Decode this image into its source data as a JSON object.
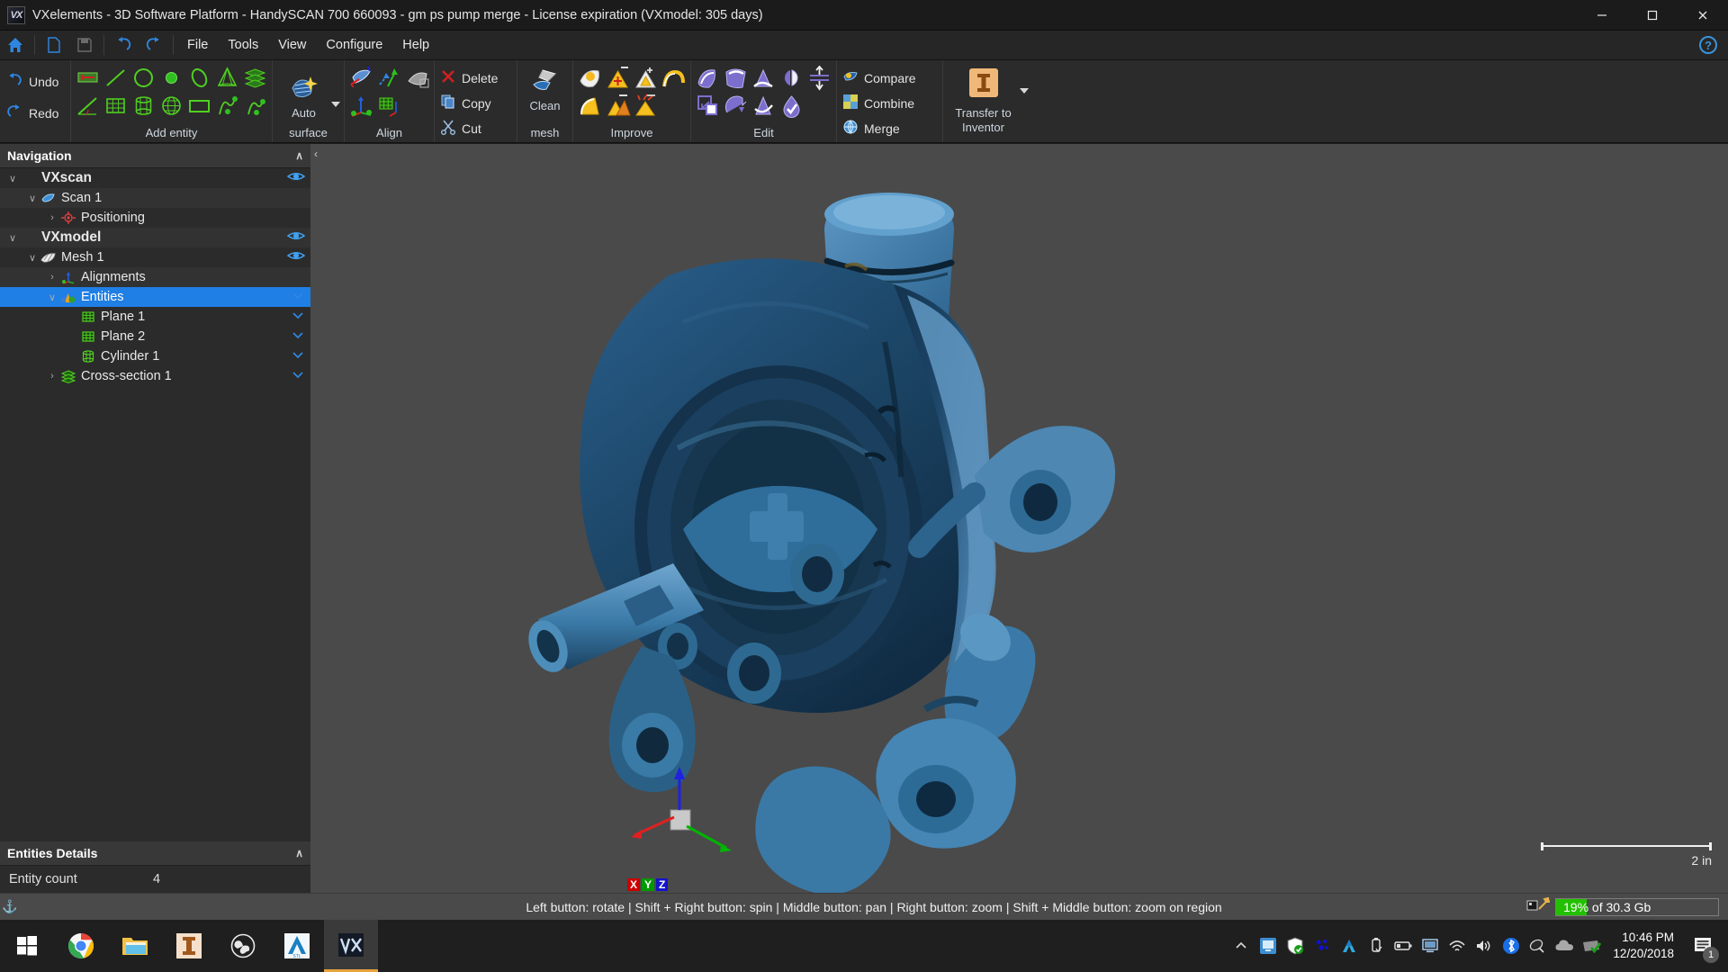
{
  "window": {
    "title": "VXelements - 3D Software Platform - HandySCAN 700 660093 - gm ps pump merge - License expiration (VXmodel: 305 days)",
    "app_icon": "vx-app-icon",
    "minimize": "—",
    "maximize": "❐",
    "close": "✕"
  },
  "menubar": {
    "icons": [
      "home-icon",
      "new-document-icon",
      "save-icon",
      "undo-nav-icon",
      "redo-nav-icon"
    ],
    "items": [
      "File",
      "Tools",
      "View",
      "Configure",
      "Help"
    ],
    "help_badge": "?"
  },
  "ribbon": {
    "history": {
      "undo_label": "Undo",
      "redo_label": "Redo"
    },
    "groups": [
      {
        "label": "Add entity"
      },
      {
        "label": "Auto\nsurface",
        "big_label_line1": "Auto",
        "big_label_line2": "surface"
      },
      {
        "label": "Align"
      },
      {
        "label": ""
      },
      {
        "label": "Clean\nmesh",
        "big_label_line1": "Clean",
        "big_label_line2": "mesh"
      },
      {
        "label": "Improve"
      },
      {
        "label": "Edit"
      },
      {
        "label": ""
      },
      {
        "label": ""
      }
    ],
    "edit_ops": {
      "delete_label": "Delete",
      "copy_label": "Copy",
      "cut_label": "Cut"
    },
    "compare_ops": {
      "compare_label": "Compare",
      "combine_label": "Combine",
      "merge_label": "Merge"
    },
    "transfer": {
      "line1": "Transfer to",
      "line2": "Inventor"
    }
  },
  "navigation": {
    "header": "Navigation",
    "collapse_chevron": "∧",
    "tree": [
      {
        "label": "VXscan",
        "indent": 0,
        "expander": "∨",
        "icon": "",
        "bold": true,
        "eye": true,
        "selected": false,
        "alt": false
      },
      {
        "label": "Scan 1",
        "indent": 1,
        "expander": "∨",
        "icon": "scan-icon",
        "bold": false,
        "eye": false,
        "selected": false,
        "alt": true
      },
      {
        "label": "Positioning",
        "indent": 2,
        "expander": "›",
        "icon": "positioning-icon",
        "bold": false,
        "eye": false,
        "selected": false,
        "alt": false
      },
      {
        "label": "VXmodel",
        "indent": 0,
        "expander": "∨",
        "icon": "",
        "bold": true,
        "eye": true,
        "selected": false,
        "alt": true
      },
      {
        "label": "Mesh 1",
        "indent": 1,
        "expander": "∨",
        "icon": "mesh-icon",
        "bold": false,
        "eye": true,
        "selected": false,
        "alt": false
      },
      {
        "label": "Alignments",
        "indent": 2,
        "expander": "›",
        "icon": "alignments-icon",
        "bold": false,
        "eye": false,
        "selected": false,
        "alt": true
      },
      {
        "label": "Entities",
        "indent": 2,
        "expander": "∨",
        "icon": "entities-icon",
        "bold": false,
        "eye": true,
        "selected": true,
        "alt": false
      },
      {
        "label": "Plane 1",
        "indent": 3,
        "expander": "",
        "icon": "plane-icon",
        "bold": false,
        "eye": true,
        "selected": false,
        "alt": false
      },
      {
        "label": "Plane 2",
        "indent": 3,
        "expander": "",
        "icon": "plane-icon",
        "bold": false,
        "eye": true,
        "selected": false,
        "alt": false
      },
      {
        "label": "Cylinder 1",
        "indent": 3,
        "expander": "",
        "icon": "cylinder-icon",
        "bold": false,
        "eye": true,
        "selected": false,
        "alt": false
      },
      {
        "label": "Cross-section 1",
        "indent": 2,
        "expander": "›",
        "icon": "cross-section-icon",
        "bold": false,
        "eye": true,
        "selected": false,
        "alt": false
      }
    ]
  },
  "entities_details": {
    "header": "Entities Details",
    "collapse_chevron": "∧",
    "rows": [
      {
        "key": "Entity count",
        "value": "4"
      }
    ]
  },
  "panel_tabs": [
    {
      "name": "tree-view-tab",
      "icon": "tree-view-icon",
      "active": true
    },
    {
      "name": "list-view-tab",
      "icon": "list-view-icon",
      "active": false
    }
  ],
  "viewport": {
    "collapse_handle": "‹",
    "scale_label": "2 in",
    "axis_labels": [
      "X",
      "Y",
      "Z"
    ],
    "axis_colors": [
      "#e02020",
      "#00b400",
      "#2020e0"
    ]
  },
  "statusbar": {
    "hints": "Left button: rotate  |  Shift + Right button: spin  |  Middle button: pan  |  Right button: zoom  |  Shift + Middle button: zoom on region",
    "memory_text": "19% of 30.3 Gb",
    "memory_percent": 19,
    "memory_color": "#22c000"
  },
  "taskbar": {
    "items": [
      {
        "name": "start-button",
        "icon": "windows-icon"
      },
      {
        "name": "chrome-task",
        "icon": "chrome-icon"
      },
      {
        "name": "file-explorer-task",
        "icon": "folder-icon"
      },
      {
        "name": "inventor-task",
        "icon": "inventor-icon"
      },
      {
        "name": "obs-task",
        "icon": "obs-icon"
      },
      {
        "name": "autodesk-task",
        "icon": "autodesk-stl-icon"
      },
      {
        "name": "vxelements-task",
        "icon": "vx-icon"
      }
    ],
    "tray": [
      "remote-desktop-icon",
      "security-shield-icon",
      "bluetooth-devices-icon",
      "autodesk-tray-icon",
      "usb-eject-icon",
      "battery-icon",
      "display-icon",
      "wifi-icon",
      "volume-icon",
      "bluetooth-icon",
      "dish-icon",
      "onedrive-icon",
      "update-check-icon"
    ],
    "clock": {
      "time": "10:46 PM",
      "date": "12/20/2018"
    },
    "notifications": {
      "icon": "notification-icon",
      "count": "1"
    }
  },
  "theme": {
    "accent": "#1f7fe5",
    "ribbon_bg": "#2b2b2b",
    "viewport_bg": "#4a4a4a",
    "mesh_color": "#2f6f9f"
  }
}
